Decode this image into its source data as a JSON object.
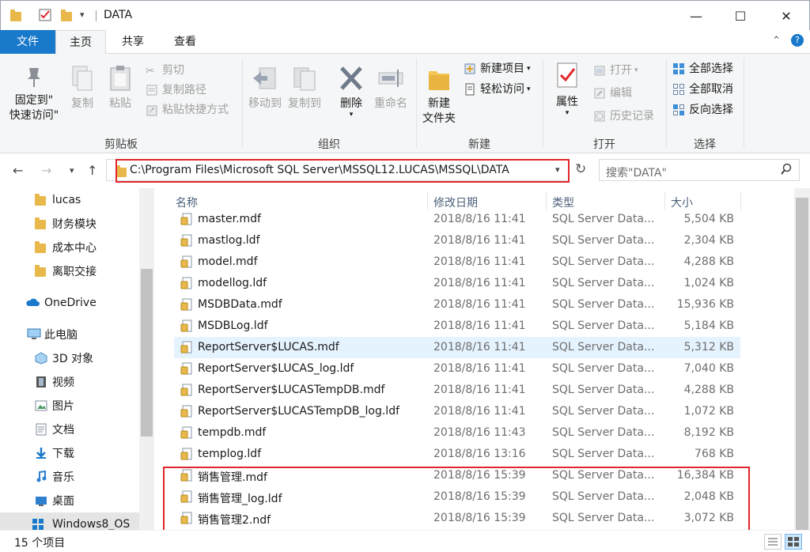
{
  "window": {
    "title": "DATA",
    "minimize_glyph": "—",
    "maximize_glyph": "☐",
    "close_glyph": "✕"
  },
  "ribbon_tabs": {
    "file": "文件",
    "home": "主页",
    "share": "共享",
    "view": "查看"
  },
  "ribbon": {
    "clipboard": {
      "group_label": "剪贴板",
      "pin_quick_access": [
        "固定到\"",
        "快速访问\""
      ],
      "copy": "复制",
      "paste": "粘贴",
      "cut": "剪切",
      "copy_path": "复制路径",
      "paste_shortcut": "粘贴快捷方式"
    },
    "organize": {
      "group_label": "组织",
      "move_to": "移动到",
      "copy_to": "复制到",
      "delete": "删除",
      "rename": "重命名"
    },
    "new": {
      "group_label": "新建",
      "new_folder": [
        "新建",
        "文件夹"
      ],
      "new_item": "新建项目",
      "easy_access": "轻松访问"
    },
    "open": {
      "group_label": "打开",
      "properties": "属性",
      "open": "打开",
      "edit": "编辑",
      "history": "历史记录"
    },
    "select": {
      "group_label": "选择",
      "select_all": "全部选择",
      "select_none": "全部取消",
      "invert": "反向选择"
    }
  },
  "address": {
    "path": "C:\\Program Files\\Microsoft SQL Server\\MSSQL12.LUCAS\\MSSQL\\DATA",
    "search_placeholder": "搜索\"DATA\""
  },
  "nav_pane": {
    "quick_items": [
      "lucas",
      "财务模块",
      "成本中心",
      "离职交接"
    ],
    "onedrive": "OneDrive",
    "this_pc": "此电脑",
    "pc_items": [
      "3D 对象",
      "视频",
      "图片",
      "文档",
      "下载",
      "音乐",
      "桌面"
    ],
    "drive": "Windows8_OS"
  },
  "columns": {
    "name": "名称",
    "date": "修改日期",
    "type": "类型",
    "size": "大小"
  },
  "files": [
    {
      "name": "master.mdf",
      "date": "2018/8/16 11:41",
      "type": "SQL Server Data...",
      "size": "5,504 KB"
    },
    {
      "name": "mastlog.ldf",
      "date": "2018/8/16 11:41",
      "type": "SQL Server Data...",
      "size": "2,304 KB"
    },
    {
      "name": "model.mdf",
      "date": "2018/8/16 11:41",
      "type": "SQL Server Data...",
      "size": "4,288 KB"
    },
    {
      "name": "modellog.ldf",
      "date": "2018/8/16 11:41",
      "type": "SQL Server Data...",
      "size": "1,024 KB"
    },
    {
      "name": "MSDBData.mdf",
      "date": "2018/8/16 11:41",
      "type": "SQL Server Data...",
      "size": "15,936 KB"
    },
    {
      "name": "MSDBLog.ldf",
      "date": "2018/8/16 11:41",
      "type": "SQL Server Data...",
      "size": "5,184 KB"
    },
    {
      "name": "ReportServer$LUCAS.mdf",
      "date": "2018/8/16 11:41",
      "type": "SQL Server Data...",
      "size": "5,312 KB"
    },
    {
      "name": "ReportServer$LUCAS_log.ldf",
      "date": "2018/8/16 11:41",
      "type": "SQL Server Data...",
      "size": "7,040 KB"
    },
    {
      "name": "ReportServer$LUCASTempDB.mdf",
      "date": "2018/8/16 11:41",
      "type": "SQL Server Data...",
      "size": "4,288 KB"
    },
    {
      "name": "ReportServer$LUCASTempDB_log.ldf",
      "date": "2018/8/16 11:41",
      "type": "SQL Server Data...",
      "size": "1,072 KB"
    },
    {
      "name": "tempdb.mdf",
      "date": "2018/8/16 11:43",
      "type": "SQL Server Data...",
      "size": "8,192 KB"
    },
    {
      "name": "templog.ldf",
      "date": "2018/8/16 13:16",
      "type": "SQL Server Data...",
      "size": "768 KB"
    },
    {
      "name": "销售管理.mdf",
      "date": "2018/8/16 15:39",
      "type": "SQL Server Data...",
      "size": "16,384 KB"
    },
    {
      "name": "销售管理_log.ldf",
      "date": "2018/8/16 15:39",
      "type": "SQL Server Data...",
      "size": "2,048 KB"
    },
    {
      "name": "销售管理2.ndf",
      "date": "2018/8/16 15:39",
      "type": "SQL Server Data...",
      "size": "3,072 KB"
    }
  ],
  "selected_row": 6,
  "status": {
    "item_count": "15 个项目"
  },
  "colors": {
    "accent": "#1979ca",
    "highlight_red": "#e0262b",
    "selection": "#e5f3ff",
    "folder": "#e8b84a"
  }
}
